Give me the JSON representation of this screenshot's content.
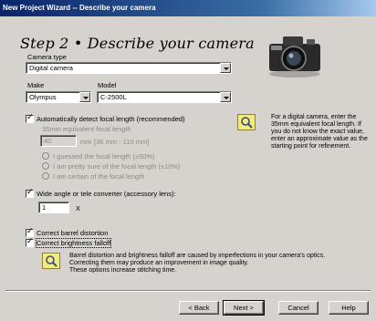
{
  "window": {
    "title": "New Project Wizard -- Describe your camera"
  },
  "step_title": "Step 2 • Describe your camera",
  "camera_type": {
    "label": "Camera type",
    "value": "Digital camera"
  },
  "make": {
    "label": "Make",
    "value": "Olympus"
  },
  "model": {
    "label": "Model",
    "value": "C-2500L"
  },
  "auto_focal": {
    "label": "Automatically detect focal length (recommended)",
    "checked": true
  },
  "focal_equiv": {
    "label": "35mm equivalent focal length",
    "value": "40",
    "unit": "mm",
    "range": "[36 mm - 110 mm]"
  },
  "guess_options": [
    "I guessed the focal length (±50%)",
    "I am pretty sure of the focal length (±10%)",
    "I am certain of the focal length"
  ],
  "focal_hint": "For a digital camera, enter the 35mm equivalent focal length.  If you do not know the exact value, enter an approximate value as the starting point for refinement.",
  "converter": {
    "label": "Wide angle or tele converter (accessory lens):",
    "checked": true,
    "value": "1",
    "suffix": "X"
  },
  "barrel": {
    "label": "Correct barrel distortion",
    "checked": true
  },
  "brightness": {
    "label": "Correct brightness falloff",
    "checked": true
  },
  "correction_hint": [
    "Barrel distortion and brightness falloff are caused by imperfections in your camera's optics.",
    "Correcting them may produce an improvement in image quality.",
    "These options increase stitching time."
  ],
  "buttons": {
    "back": "< Back",
    "next": "Next >",
    "cancel": "Cancel",
    "help": "Help"
  },
  "colors": {
    "title_bar_start": "#0a246a",
    "title_bar_end": "#a6caf0",
    "dialog_bg": "#d6d3ce",
    "hint_icon": "#f4ec7a"
  }
}
